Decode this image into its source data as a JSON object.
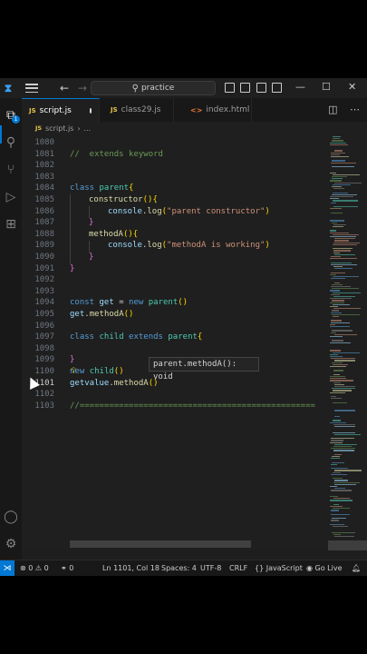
{
  "titlebar": {
    "search_text": "practice",
    "back_icon": "arrow-left-icon",
    "forward_icon": "arrow-right-icon",
    "window_minimize": "—",
    "window_maximize": "☐",
    "window_close": "✕"
  },
  "activity": {
    "explorer_badge": "1"
  },
  "tabs": [
    {
      "label": "script.js",
      "icon_text": "JS",
      "active": true,
      "dirty": true
    },
    {
      "label": "class29.js",
      "icon_text": "JS",
      "active": false
    },
    {
      "label": "index.html",
      "icon_text": "<>",
      "active": false
    }
  ],
  "breadcrumb": {
    "icon_text": "JS",
    "file": "script.js",
    "sep": "›",
    "rest": "..."
  },
  "editor": {
    "lines": [
      {
        "num": "1080",
        "text": ""
      },
      {
        "num": "1081",
        "text": "//  extends keyword"
      },
      {
        "num": "1082",
        "text": ""
      },
      {
        "num": "1083",
        "text": ""
      },
      {
        "num": "1084",
        "text": "class parent{"
      },
      {
        "num": "1085",
        "text": "constructor(){"
      },
      {
        "num": "1086",
        "text": "console.log(\"parent constructor\")"
      },
      {
        "num": "1087",
        "text": "}"
      },
      {
        "num": "1088",
        "text": "methodA(){"
      },
      {
        "num": "1089",
        "text": "console.log(\"methodA is working\")"
      },
      {
        "num": "1090",
        "text": "}"
      },
      {
        "num": "1091",
        "text": "}"
      },
      {
        "num": "1092",
        "text": ""
      },
      {
        "num": "1093",
        "text": ""
      },
      {
        "num": "1094",
        "text": "const get = new parent()"
      },
      {
        "num": "1095",
        "text": "get.methodA()"
      },
      {
        "num": "1096",
        "text": ""
      },
      {
        "num": "1097",
        "text": "class child extends parent{"
      },
      {
        "num": "1098",
        "text": ""
      },
      {
        "num": "1099",
        "text": "}"
      },
      {
        "num": "1100",
        "text": "new child()"
      },
      {
        "num": "1101",
        "text": "getvalue.methodA()"
      },
      {
        "num": "1102",
        "text": ""
      },
      {
        "num": "1103",
        "text": "//================================================"
      }
    ],
    "hover_tip": "parent.methodA(): void"
  },
  "statusbar": {
    "errors": "0",
    "warnings": "0",
    "ports": "0",
    "position": "Ln 1101, Col 18",
    "spaces": "Spaces: 4",
    "encoding": "UTF-8",
    "eol": "CRLF",
    "language": "JavaScript",
    "golive": "Go Live"
  },
  "colors": {
    "accent": "#0078d4",
    "keyword": "#569cd6",
    "class": "#4ec9b0",
    "function": "#dcdcaa",
    "string": "#ce9178",
    "comment": "#6a9955"
  }
}
